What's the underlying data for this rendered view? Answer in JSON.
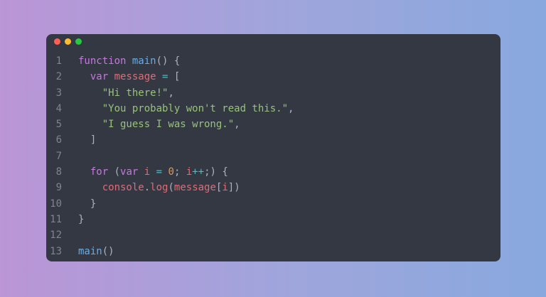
{
  "window": {
    "controls": [
      {
        "name": "close",
        "color": "#ff5f56"
      },
      {
        "name": "minimize",
        "color": "#ffbd2e"
      },
      {
        "name": "maximize",
        "color": "#27c93f"
      }
    ]
  },
  "colors": {
    "keyword": "#c678dd",
    "function": "#61afef",
    "variable": "#e06c75",
    "operator": "#56b6c2",
    "string": "#98c379",
    "number": "#d19a66",
    "punctuation": "#abb2bf",
    "line_number": "#7f848e",
    "editor_background": "#333843"
  },
  "code": {
    "lines": [
      {
        "number": "1",
        "tokens": [
          {
            "t": "keyword",
            "v": "function"
          },
          {
            "t": "text",
            "v": " "
          },
          {
            "t": "function",
            "v": "main"
          },
          {
            "t": "punctuation",
            "v": "() {"
          }
        ]
      },
      {
        "number": "2",
        "tokens": [
          {
            "t": "text",
            "v": "  "
          },
          {
            "t": "keyword",
            "v": "var"
          },
          {
            "t": "text",
            "v": " "
          },
          {
            "t": "variable",
            "v": "message"
          },
          {
            "t": "text",
            "v": " "
          },
          {
            "t": "operator",
            "v": "="
          },
          {
            "t": "text",
            "v": " "
          },
          {
            "t": "punctuation",
            "v": "["
          }
        ]
      },
      {
        "number": "3",
        "tokens": [
          {
            "t": "text",
            "v": "    "
          },
          {
            "t": "string",
            "v": "\"Hi there!\""
          },
          {
            "t": "punctuation",
            "v": ","
          }
        ]
      },
      {
        "number": "4",
        "tokens": [
          {
            "t": "text",
            "v": "    "
          },
          {
            "t": "string",
            "v": "\"You probably won't read this.\""
          },
          {
            "t": "punctuation",
            "v": ","
          }
        ]
      },
      {
        "number": "5",
        "tokens": [
          {
            "t": "text",
            "v": "    "
          },
          {
            "t": "string",
            "v": "\"I guess I was wrong.\""
          },
          {
            "t": "punctuation",
            "v": ","
          }
        ]
      },
      {
        "number": "6",
        "tokens": [
          {
            "t": "text",
            "v": "  "
          },
          {
            "t": "punctuation",
            "v": "]"
          }
        ]
      },
      {
        "number": "7",
        "tokens": []
      },
      {
        "number": "8",
        "tokens": [
          {
            "t": "text",
            "v": "  "
          },
          {
            "t": "keyword",
            "v": "for"
          },
          {
            "t": "text",
            "v": " "
          },
          {
            "t": "punctuation",
            "v": "("
          },
          {
            "t": "keyword",
            "v": "var"
          },
          {
            "t": "text",
            "v": " "
          },
          {
            "t": "variable",
            "v": "i"
          },
          {
            "t": "text",
            "v": " "
          },
          {
            "t": "operator",
            "v": "="
          },
          {
            "t": "text",
            "v": " "
          },
          {
            "t": "number",
            "v": "0"
          },
          {
            "t": "punctuation",
            "v": "; "
          },
          {
            "t": "variable",
            "v": "i"
          },
          {
            "t": "operator",
            "v": "++"
          },
          {
            "t": "punctuation",
            "v": ";) {"
          }
        ]
      },
      {
        "number": "9",
        "tokens": [
          {
            "t": "text",
            "v": "    "
          },
          {
            "t": "variable",
            "v": "console"
          },
          {
            "t": "punctuation",
            "v": "."
          },
          {
            "t": "variable",
            "v": "log"
          },
          {
            "t": "punctuation",
            "v": "("
          },
          {
            "t": "variable",
            "v": "message"
          },
          {
            "t": "punctuation",
            "v": "["
          },
          {
            "t": "variable",
            "v": "i"
          },
          {
            "t": "punctuation",
            "v": "])"
          }
        ]
      },
      {
        "number": "10",
        "tokens": [
          {
            "t": "text",
            "v": "  "
          },
          {
            "t": "punctuation",
            "v": "}"
          }
        ]
      },
      {
        "number": "11",
        "tokens": [
          {
            "t": "punctuation",
            "v": "}"
          }
        ]
      },
      {
        "number": "12",
        "tokens": []
      },
      {
        "number": "13",
        "tokens": [
          {
            "t": "function",
            "v": "main"
          },
          {
            "t": "punctuation",
            "v": "()"
          }
        ]
      }
    ]
  }
}
